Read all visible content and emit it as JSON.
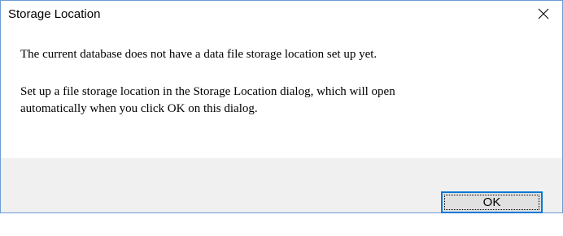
{
  "window": {
    "title": "Storage Location",
    "close_icon": "close-icon"
  },
  "message": {
    "line1": "The current database does not have a data file storage location set up yet.",
    "line2": "Set up a file storage location in the Storage Location dialog, which will open",
    "line3": "automatically when you click OK on this dialog."
  },
  "buttons": {
    "ok_label": "OK"
  },
  "colors": {
    "border": "#6b9bd1",
    "footer_bg": "#f0f0f0",
    "button_bg": "#e1e1e1",
    "button_focus_border": "#0078d7"
  }
}
